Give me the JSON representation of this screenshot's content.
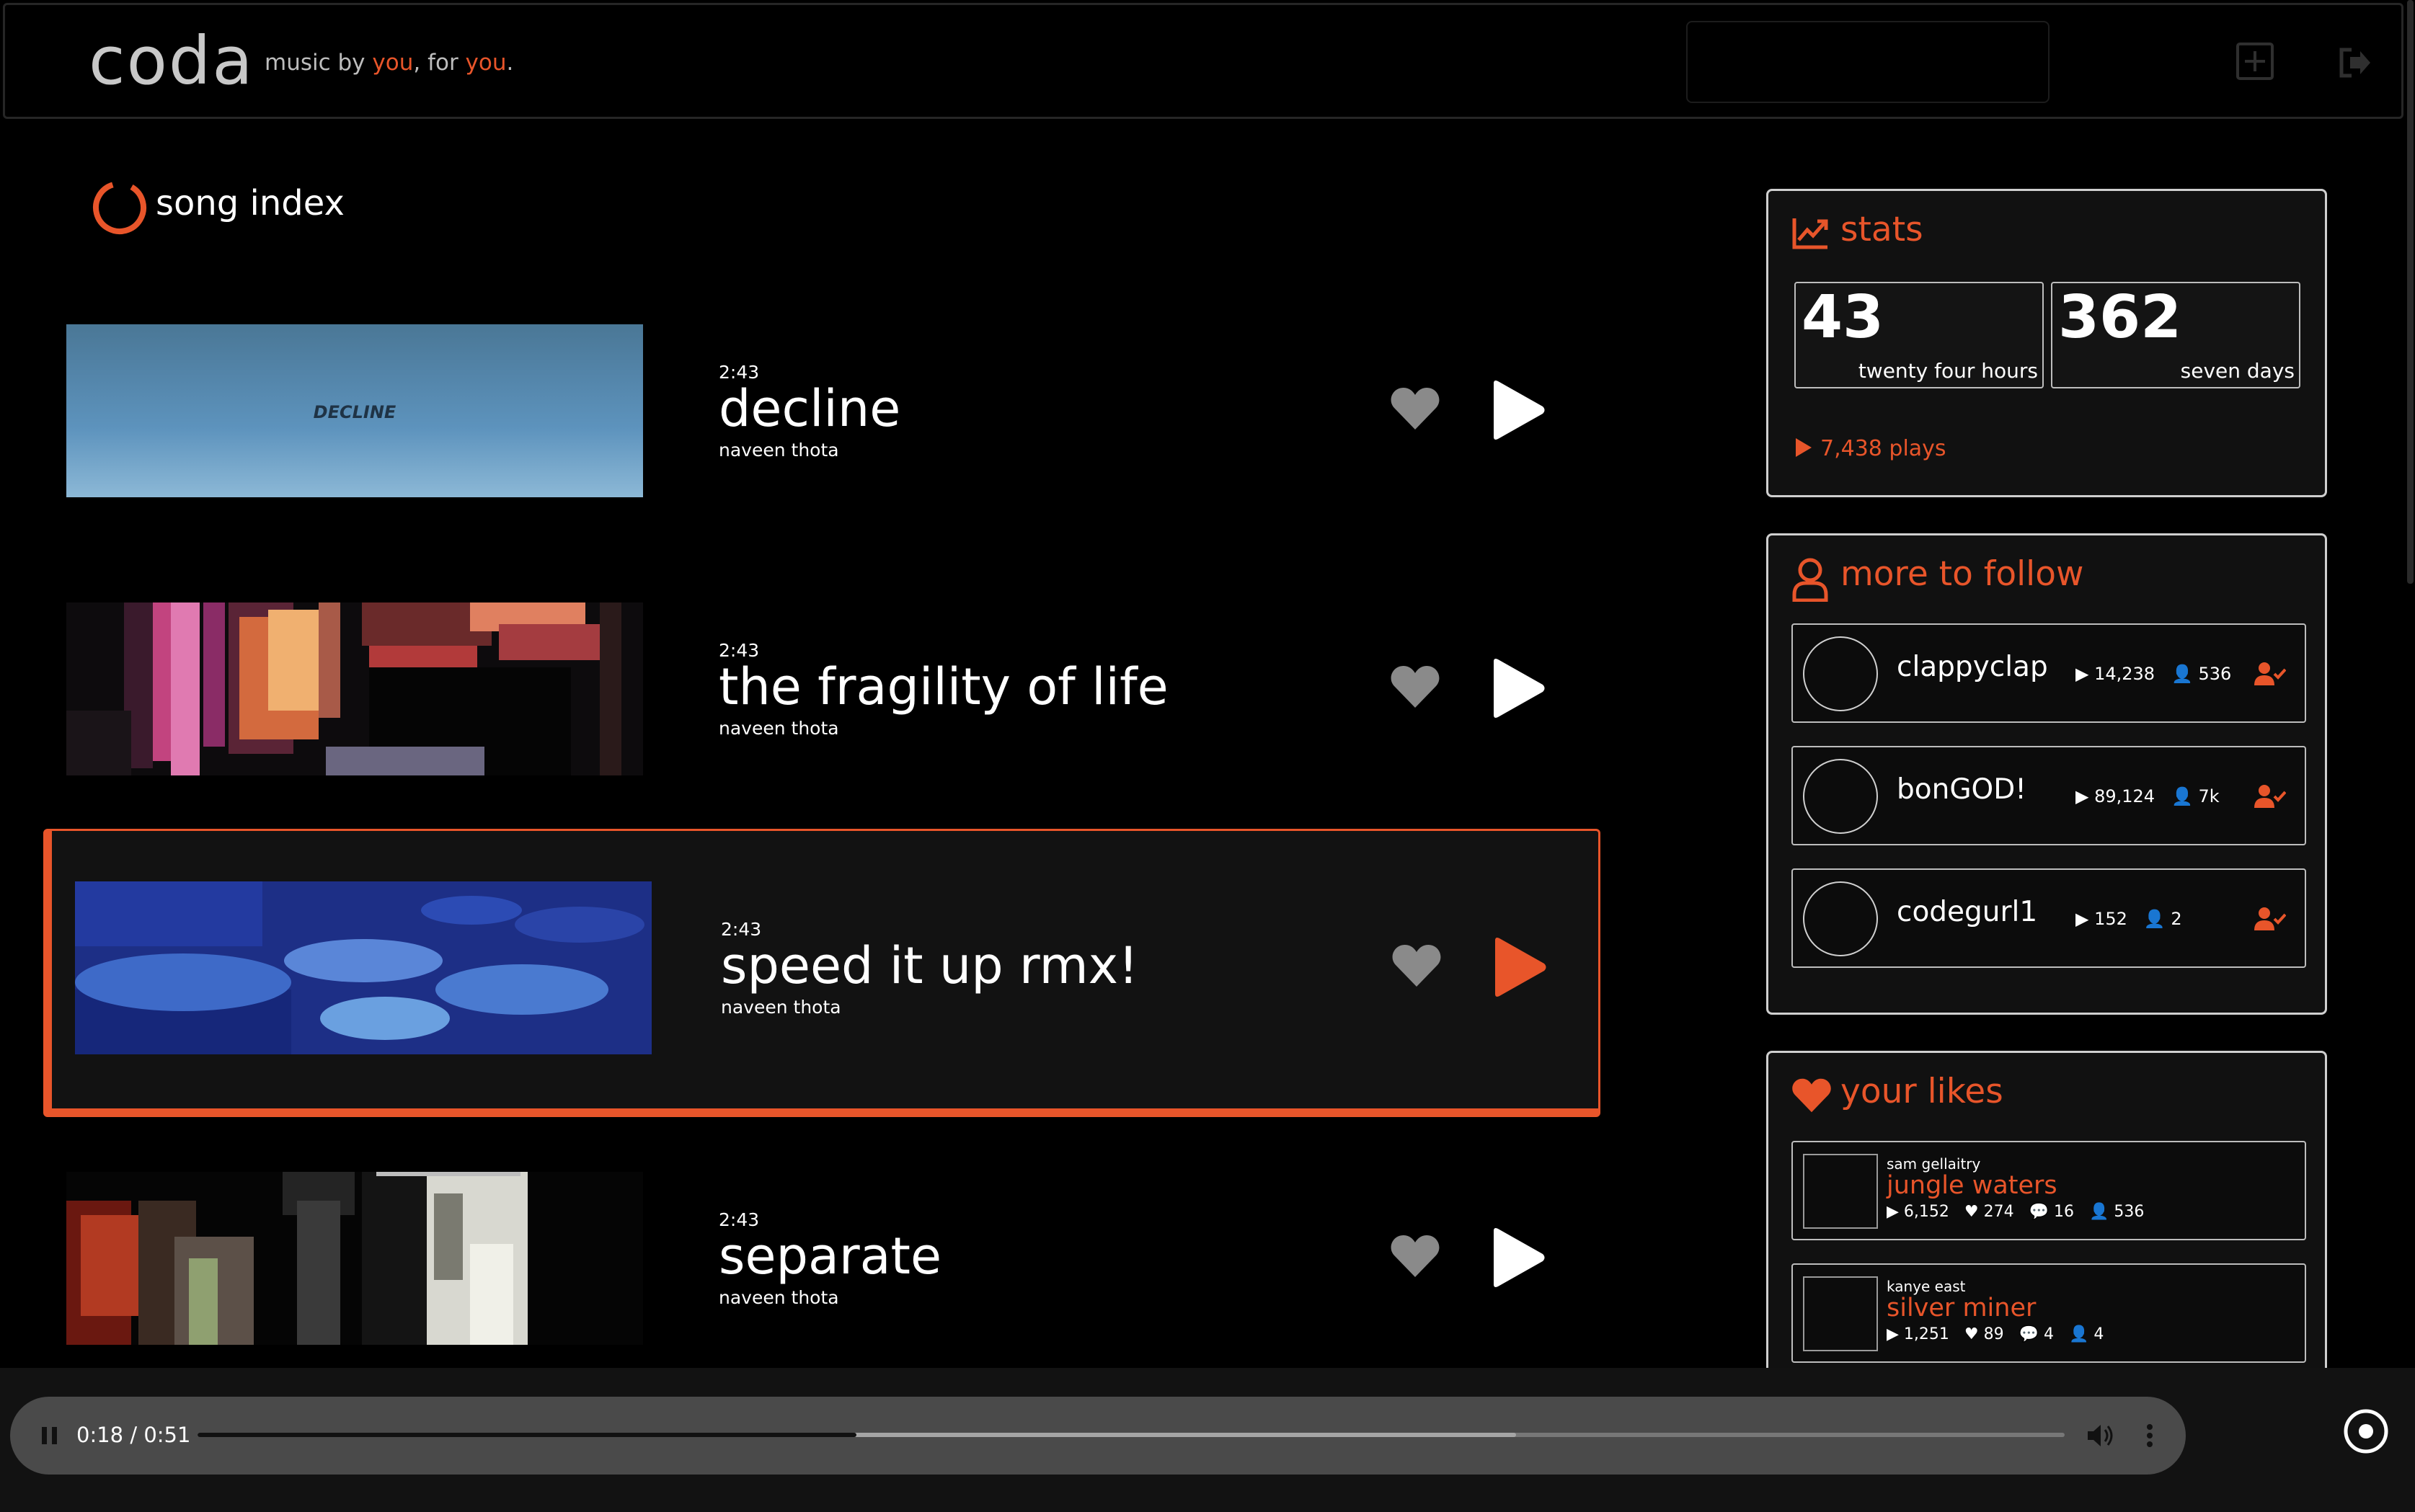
{
  "header": {
    "logo": "coda",
    "tagline_parts": [
      "music by ",
      "you",
      ", for ",
      "you",
      "."
    ],
    "accent_color": "#e8552a",
    "search_placeholder": ""
  },
  "song_index": {
    "title": "song index",
    "songs": [
      {
        "title": "decline",
        "artist": "naveen thota",
        "length": "2:43",
        "cover_text": "DECLINE",
        "playing": false
      },
      {
        "title": "the fragility of life",
        "artist": "naveen thota",
        "length": "2:43",
        "cover_text": "",
        "playing": false
      },
      {
        "title": "speed it up rmx!",
        "artist": "naveen thota",
        "length": "2:43",
        "cover_text": "",
        "playing": true
      },
      {
        "title": "separate",
        "artist": "naveen thota",
        "length": "2:43",
        "cover_text": "",
        "playing": false
      }
    ]
  },
  "stats": {
    "title": "stats",
    "boxes": [
      {
        "value": "43",
        "label": "twenty four hours"
      },
      {
        "value": "362",
        "label": "seven days"
      }
    ],
    "plays": "7,438 plays"
  },
  "more_to_follow": {
    "title": "more to follow",
    "users": [
      {
        "name": "clappyclap",
        "plays": "14,238",
        "followers": "536"
      },
      {
        "name": "bonGOD!",
        "plays": "89,124",
        "followers": "7k"
      },
      {
        "name": "codegurl1",
        "plays": "152",
        "followers": "2"
      }
    ]
  },
  "your_likes": {
    "title": "your likes",
    "items": [
      {
        "artist": "sam gellaitry",
        "title": "jungle waters",
        "plays": "6,152",
        "likes": "274",
        "comments": "16",
        "followers": "536"
      },
      {
        "artist": "kanye east",
        "title": "silver miner",
        "plays": "1,251",
        "likes": "89",
        "comments": "4",
        "followers": "4"
      }
    ]
  },
  "player": {
    "time": "0:18 / 0:51",
    "progress_fraction": 0.353,
    "buffered_fraction": 0.706
  }
}
